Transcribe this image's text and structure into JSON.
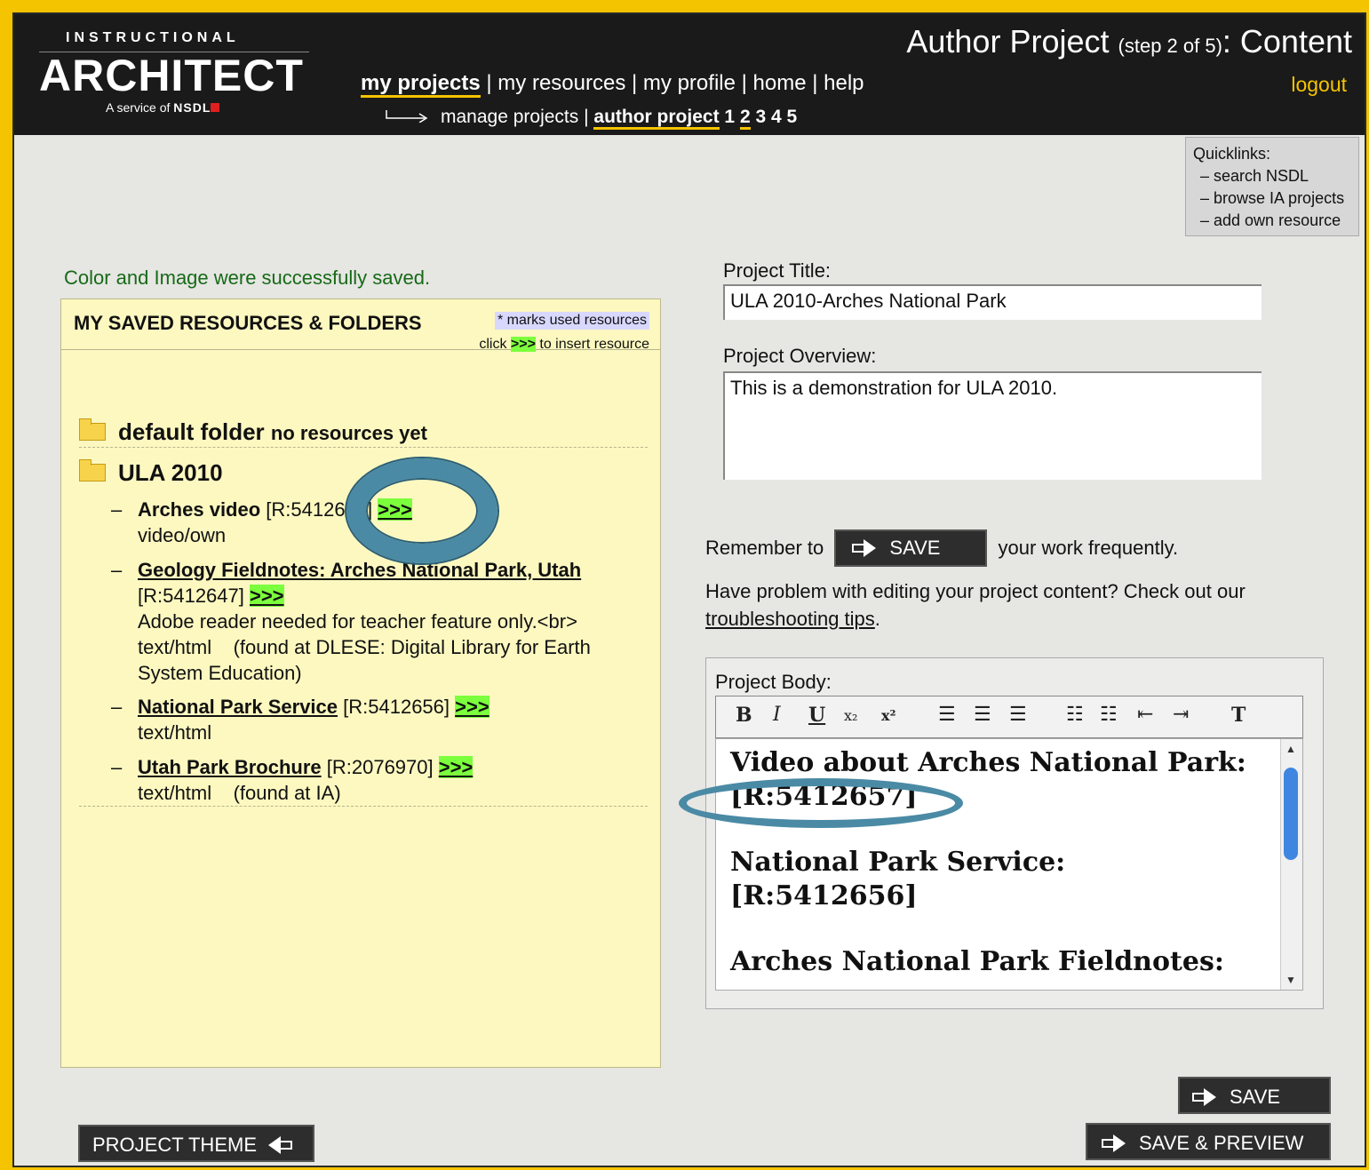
{
  "header": {
    "logo_small": "INSTRUCTIONAL",
    "logo_big": "ARCHITECT",
    "logo_service": "A service of",
    "logo_nsdl": "NSDL",
    "title_main": "Author Project",
    "title_step": "(step 2 of 5)",
    "title_suffix": ": Content",
    "logout": "logout",
    "nav": [
      "my projects",
      "my resources",
      "my profile",
      "home",
      "help"
    ],
    "subnav": {
      "manage": "manage projects",
      "author": "author project",
      "steps": [
        "1",
        "2",
        "3",
        "4",
        "5"
      ]
    }
  },
  "quicklinks": {
    "title": "Quicklinks:",
    "items": [
      "– search NSDL",
      "– browse IA projects",
      "– add own resource"
    ]
  },
  "saved_message": "Color and Image were successfully saved.",
  "panel": {
    "title": "MY SAVED RESOURCES & FOLDERS",
    "marks": "* marks used resources",
    "click_prefix": "click",
    "click_arrow": ">>>",
    "click_suffix": "to insert resource",
    "folders": [
      {
        "name": "default folder",
        "note": "no resources yet"
      },
      {
        "name": "ULA 2010"
      }
    ],
    "resources": [
      {
        "title": "Arches video",
        "id": "[R:5412657]",
        "insert": ">>>",
        "meta": "video/own"
      },
      {
        "title": "Geology Fieldnotes: Arches National Park, Utah",
        "id": "[R:5412647]",
        "insert": ">>>",
        "desc": "Adobe reader needed for teacher feature only.<br>",
        "meta": "text/html    (found at DLESE: Digital Library for Earth System Education)"
      },
      {
        "title": "National Park Service",
        "id": "[R:5412656]",
        "insert": ">>>",
        "meta": "text/html"
      },
      {
        "title": "Utah Park Brochure",
        "id": "[R:2076970]",
        "insert": ">>>",
        "meta": "text/html    (found at IA)"
      }
    ]
  },
  "form": {
    "title_label": "Project Title:",
    "title_value": "ULA 2010-Arches National Park",
    "overview_label": "Project Overview:",
    "overview_value": "This is a demonstration for ULA 2010.",
    "remember_prefix": "Remember to",
    "remember_suffix": "your work frequently.",
    "save_label": "SAVE",
    "help_text": "Have problem with editing your project content? Check out our",
    "help_link": "troubleshooting tips",
    "body_label": "Project Body:",
    "body_lines": [
      "Video about Arches National Park:",
      "[R:5412657]",
      "National Park Service:",
      "[R:5412656]",
      "Arches National Park Fieldnotes:"
    ]
  },
  "buttons": {
    "save": "SAVE",
    "save_preview": "SAVE & PREVIEW",
    "project_theme": "PROJECT THEME"
  },
  "colors": {
    "frame": "#f5c400",
    "header_bg": "#1a1a1a",
    "panel_bg": "#fcf8c0",
    "insert_green": "#7cff3c",
    "success_text": "#166a16",
    "highlight_ring": "#4a8aa5"
  }
}
